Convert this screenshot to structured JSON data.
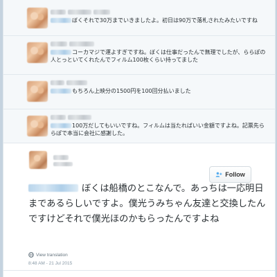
{
  "replies": [
    {
      "text": "ぼくそれで30万までいきましたよ。初日は90万で落札されたみたいですね"
    },
    {
      "text": "コーカマジで運よすぎですね。ぼくは仕事だったんで無理でしたが、ららぽの人とっといてくれたんでフィルム100枚くらい持ってました"
    },
    {
      "text": "もちろん上映分の1500円を100回分払いました"
    },
    {
      "text": "100万だしてもいいですね。フィルムは当たればいい金額ですよね。記票先ららぽで本当に会社に感謝した。"
    }
  ],
  "main_tweet": {
    "follow_label": "Follow",
    "text": "ぼくは船橋のとこなんで。あっちは一応明日まであるらしいですよ。僕光うみちゃん友達と交換したんですけどそれで僕光ほのかもらったんですよね",
    "translate_label": "View translation",
    "timestamp": "8:48 AM - 21 Jul 2015"
  },
  "colors": {
    "accent": "#55acee",
    "background": "#c5d3df",
    "text": "#292f33",
    "muted": "#8899a6"
  },
  "icons": {
    "follow": "add-user-icon",
    "translate": "globe-icon"
  }
}
